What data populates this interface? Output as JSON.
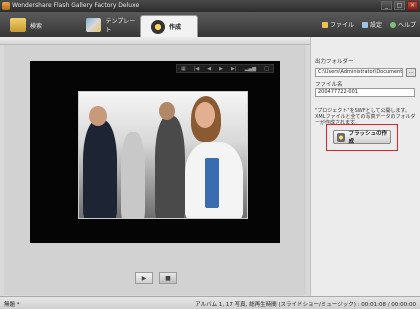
{
  "window": {
    "title": "Wondershare Flash Gallery Factory Deluxe",
    "controls": [
      "_",
      "□",
      "✕"
    ]
  },
  "toolbar": {
    "tabs": [
      {
        "label": "検索"
      },
      {
        "label": "テンプレート"
      },
      {
        "label": "作成"
      }
    ],
    "menu": [
      {
        "label": "ファイル",
        "icon": "file-icon"
      },
      {
        "label": "設定",
        "icon": "gear-icon"
      },
      {
        "label": "ヘルプ",
        "icon": "help-icon"
      }
    ]
  },
  "right_panel": {
    "output_folder_label": "出力フォルダー",
    "output_folder_value": "C:\\Users\\Administrator\\Documents\\",
    "browse_label": "...",
    "file_name_label": "ファイル名",
    "file_name_value": "200477722-001",
    "note": "\"プロジェクト\"をSWFとして公開します。XMLファイルと全ての写真データのフォルダーが作成されます。",
    "flash_button_label": "フラッシュの作成"
  },
  "statusbar": {
    "left": "無題 *",
    "right": "アルバム 1, 17 写真, 総再生時間 (スライドショー/ミュージック) : 00:01:08 / 00:00:00"
  },
  "colors": {
    "highlight": "#e0242a",
    "accent": "#ffd65a"
  }
}
